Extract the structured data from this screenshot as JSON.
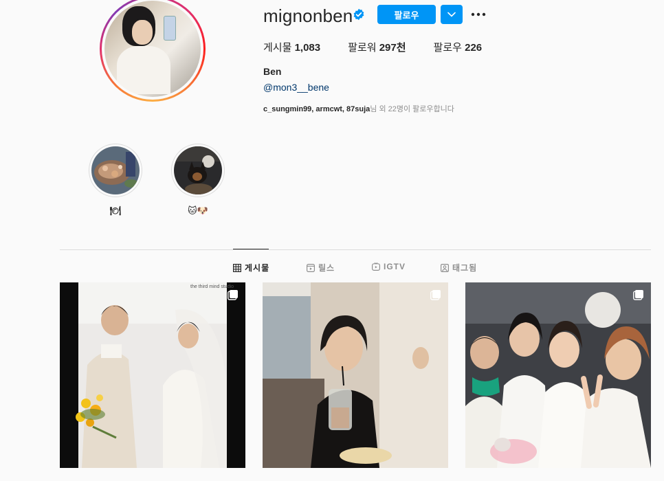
{
  "profile": {
    "username": "mignonben",
    "verified": true,
    "follow_label": "팔로우",
    "stats": [
      {
        "label": "게시물",
        "value": "1,083"
      },
      {
        "label": "팔로워",
        "value": "297천"
      },
      {
        "label": "팔로우",
        "value": "226"
      }
    ],
    "name": "Ben",
    "link": "@mon3__bene",
    "followed_by_names": "c_sungmin99, armcwt, 87suja",
    "followed_by_suffix": "님 외 22명이 팔로우합니다"
  },
  "highlights": [
    {
      "label": "🍽",
      "icon": "food-photo"
    },
    {
      "label": "🐱🐶",
      "icon": "pets-photo"
    }
  ],
  "tabs": [
    {
      "label": "게시물",
      "icon": "grid-icon",
      "active": true
    },
    {
      "label": "릴스",
      "icon": "reels-icon",
      "active": false
    },
    {
      "label": "IGTV",
      "icon": "igtv-icon",
      "active": false
    },
    {
      "label": "태그됨",
      "icon": "tagged-icon",
      "active": false
    }
  ],
  "posts": [
    {
      "kind": "wedding-photo",
      "multi": true,
      "overlay_text": "the third mind studio"
    },
    {
      "kind": "cafe-photo",
      "multi": true
    },
    {
      "kind": "group-photo",
      "multi": true
    }
  ],
  "colors": {
    "accent": "#0095f6",
    "link": "#00376b",
    "muted": "#8e8e8e",
    "border": "#dbdbdb"
  }
}
